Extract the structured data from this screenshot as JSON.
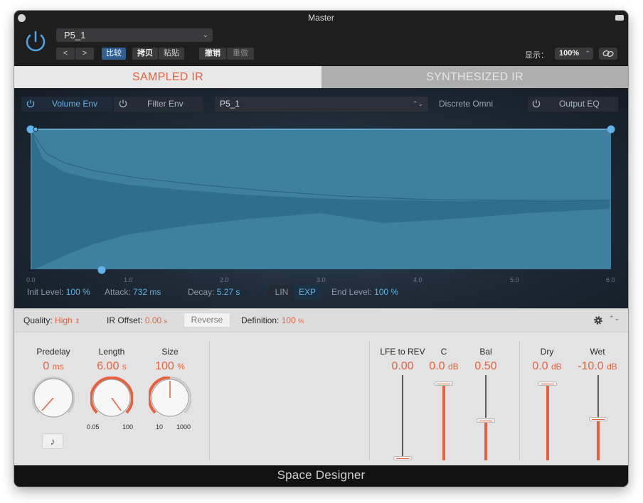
{
  "window": {
    "title": "Master"
  },
  "header": {
    "preset": "P5_1",
    "nav_prev": "<",
    "nav_next": ">",
    "compare": "比较",
    "copy": "拷贝",
    "paste": "粘贴",
    "undo": "撤销",
    "redo": "重做",
    "view_label": "显示：",
    "zoom": "100%"
  },
  "tabs": {
    "sampled": "SAMPLED IR",
    "synthesized": "SYNTHESIZED IR"
  },
  "env": {
    "volume_env": "Volume Env",
    "filter_env": "Filter Env",
    "ir_preset": "P5_1",
    "discrete_omni": "Discrete Omni",
    "output_eq": "Output EQ",
    "ticks": [
      "0.0",
      "1.0",
      "2.0",
      "3.0",
      "4.0",
      "5.0",
      "6.0"
    ],
    "init_level_label": "Init Level:",
    "init_level_value": "100 %",
    "attack_label": "Attack:",
    "attack_value": "732 ms",
    "decay_label": "Decay:",
    "decay_value": "5.27 s",
    "lin": "LIN",
    "exp": "EXP",
    "end_level_label": "End Level:",
    "end_level_value": "100 %"
  },
  "quality_bar": {
    "quality_label": "Quality:",
    "quality_value": "High",
    "ir_offset_label": "IR Offset:",
    "ir_offset_value": "0.00",
    "ir_offset_unit": "s",
    "reverse": "Reverse",
    "definition_label": "Definition:",
    "definition_value": "100",
    "definition_unit": "%"
  },
  "knobs": {
    "predelay": {
      "label": "Predelay",
      "value": "0",
      "unit": "ms"
    },
    "length": {
      "label": "Length",
      "value": "6.00",
      "unit": "s",
      "min": "0.05",
      "max": "100"
    },
    "size": {
      "label": "Size",
      "value": "100",
      "unit": "%",
      "min": "10",
      "max": "1000"
    },
    "note_icon": "♪"
  },
  "faders": {
    "lfe": {
      "label": "LFE to REV",
      "value": "0.00",
      "unit": ""
    },
    "c": {
      "label": "C",
      "value": "0.0",
      "unit": "dB"
    },
    "bal": {
      "label": "Bal",
      "value": "0.50",
      "unit": ""
    },
    "dry": {
      "label": "Dry",
      "value": "0.0",
      "unit": "dB"
    },
    "wet": {
      "label": "Wet",
      "value": "-10.0",
      "unit": "dB"
    }
  },
  "footer": {
    "title": "Space Designer"
  },
  "colors": {
    "accent_orange": "#e8603c",
    "accent_blue": "#5fb3e8",
    "compare_active": "#2f5f93"
  }
}
